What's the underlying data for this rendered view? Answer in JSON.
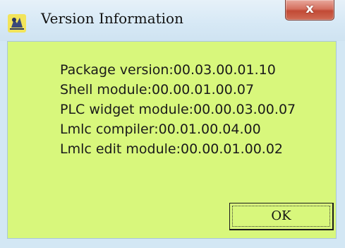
{
  "window": {
    "title": "Version Information",
    "close_glyph": "x"
  },
  "icons": {
    "app_icon": "application-icon",
    "close_icon": "close-icon"
  },
  "colors": {
    "client_background": "#d8f77c",
    "titlebar": "#d6e8f5",
    "close_button": "#c24a35"
  },
  "info": {
    "lines": [
      "Package version:00.03.00.01.10",
      "Shell module:00.00.01.00.07",
      "PLC widget module:00.00.03.00.07",
      "Lmlc compiler:00.01.00.04.00",
      "Lmlc edit module:00.00.01.00.02"
    ]
  },
  "buttons": {
    "ok_label": "OK"
  }
}
